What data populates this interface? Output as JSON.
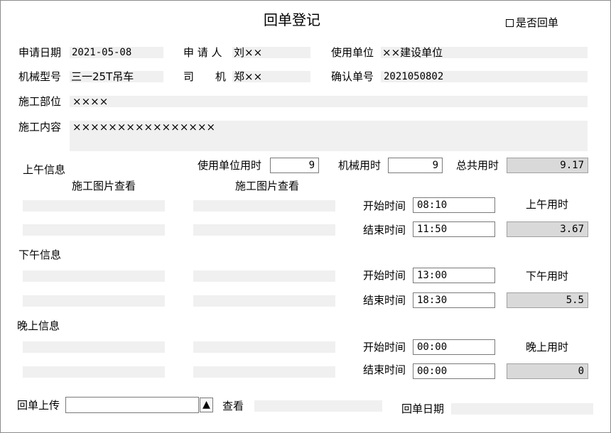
{
  "form": {
    "title": "回单登记",
    "return_checkbox_label": "是否回单",
    "apply_date_label": "申请日期",
    "apply_date_value": "2021-05-08",
    "applicant_label": "申 请 人",
    "applicant_value": "刘××",
    "use_unit_label": "使用单位",
    "use_unit_value": "××建设单位",
    "machine_model_label": "机械型号",
    "machine_model_value": "三一25T吊车",
    "driver_label": "司　　机",
    "driver_value": "郑××",
    "confirm_no_label": "确认单号",
    "confirm_no_value": "2021050802",
    "site_label": "施工部位",
    "site_value": "××××",
    "content_label": "施工内容",
    "content_value": "××××××××××××××××"
  },
  "hours": {
    "morning_section_label": "上午信息",
    "unit_hours_label": "使用单位用时",
    "unit_hours_value": "9",
    "machine_hours_label": "机械用时",
    "machine_hours_value": "9",
    "total_hours_label": "总共用时",
    "total_hours_value": "9.17"
  },
  "photos": {
    "view_label_1": "施工图片查看",
    "view_label_2": "施工图片查看"
  },
  "morning": {
    "start_label": "开始时间",
    "start_value": "08:10",
    "end_label": "结束时间",
    "end_value": "11:50",
    "duration_label": "上午用时",
    "duration_value": "3.67"
  },
  "afternoon": {
    "section_label": "下午信息",
    "start_label": "开始时间",
    "start_value": "13:00",
    "end_label": "结束时间",
    "end_value": "18:30",
    "duration_label": "下午用时",
    "duration_value": "5.5"
  },
  "evening": {
    "section_label": "晚上信息",
    "start_label": "开始时间",
    "start_value": "00:00",
    "end_label": "结束时间",
    "end_value": "00:00",
    "duration_label": "晚上用时",
    "duration_value": "0"
  },
  "footer": {
    "upload_label": "回单上传",
    "upload_button_glyph": "▲",
    "view_label": "查看",
    "return_date_label": "回单日期"
  }
}
